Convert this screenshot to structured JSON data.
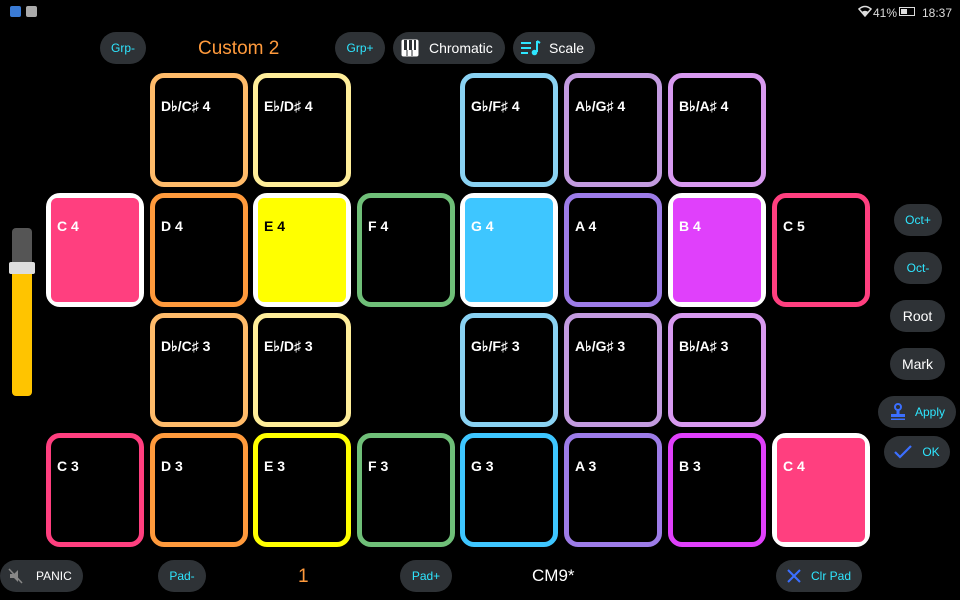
{
  "status_bar": {
    "battery": "41%",
    "time": "18:37"
  },
  "header": {
    "grp_minus": "Grp-",
    "group_name": "Custom 2",
    "grp_plus": "Grp+",
    "chromatic": "Chromatic",
    "scale": "Scale"
  },
  "pads": {
    "r1": [
      "D♭/C♯ 4",
      "E♭/D♯ 4",
      "G♭/F♯ 4",
      "A♭/G♯ 4",
      "B♭/A♯ 4"
    ],
    "r2": [
      "C 4",
      "D 4",
      "E 4",
      "F 4",
      "G 4",
      "A 4",
      "B 4",
      "C 5"
    ],
    "r3": [
      "D♭/C♯ 3",
      "E♭/D♯ 3",
      "G♭/F♯ 3",
      "A♭/G♯ 3",
      "B♭/A♯ 3"
    ],
    "r4": [
      "C 3",
      "D 3",
      "E 3",
      "F 3",
      "G 3",
      "A 3",
      "B 3",
      "C 4"
    ]
  },
  "right_panel": {
    "oct_plus": "Oct+",
    "oct_minus": "Oct-",
    "root": "Root",
    "mark": "Mark",
    "apply": "Apply",
    "ok": "OK"
  },
  "footer": {
    "panic": "PANIC",
    "pad_minus": "Pad-",
    "pad_number": "1",
    "pad_plus": "Pad+",
    "chord": "CM9*",
    "clr_pad": "Clr Pad"
  },
  "colors": {
    "c": "#ff3f7f",
    "csharp": "#ffbb6a",
    "d": "#ff9a3c",
    "dsharp": "#ffee9a",
    "e": "#ffff00",
    "f": "#6fbf78",
    "fsharp": "#8ad2f2",
    "g": "#3ec6ff",
    "gsharp": "#c39be0",
    "a": "#9d7ce8",
    "asharp": "#d89af0",
    "b": "#e040fb",
    "accent_cyan": "#2ee6ff",
    "accent_orange": "#ff9a3c"
  }
}
